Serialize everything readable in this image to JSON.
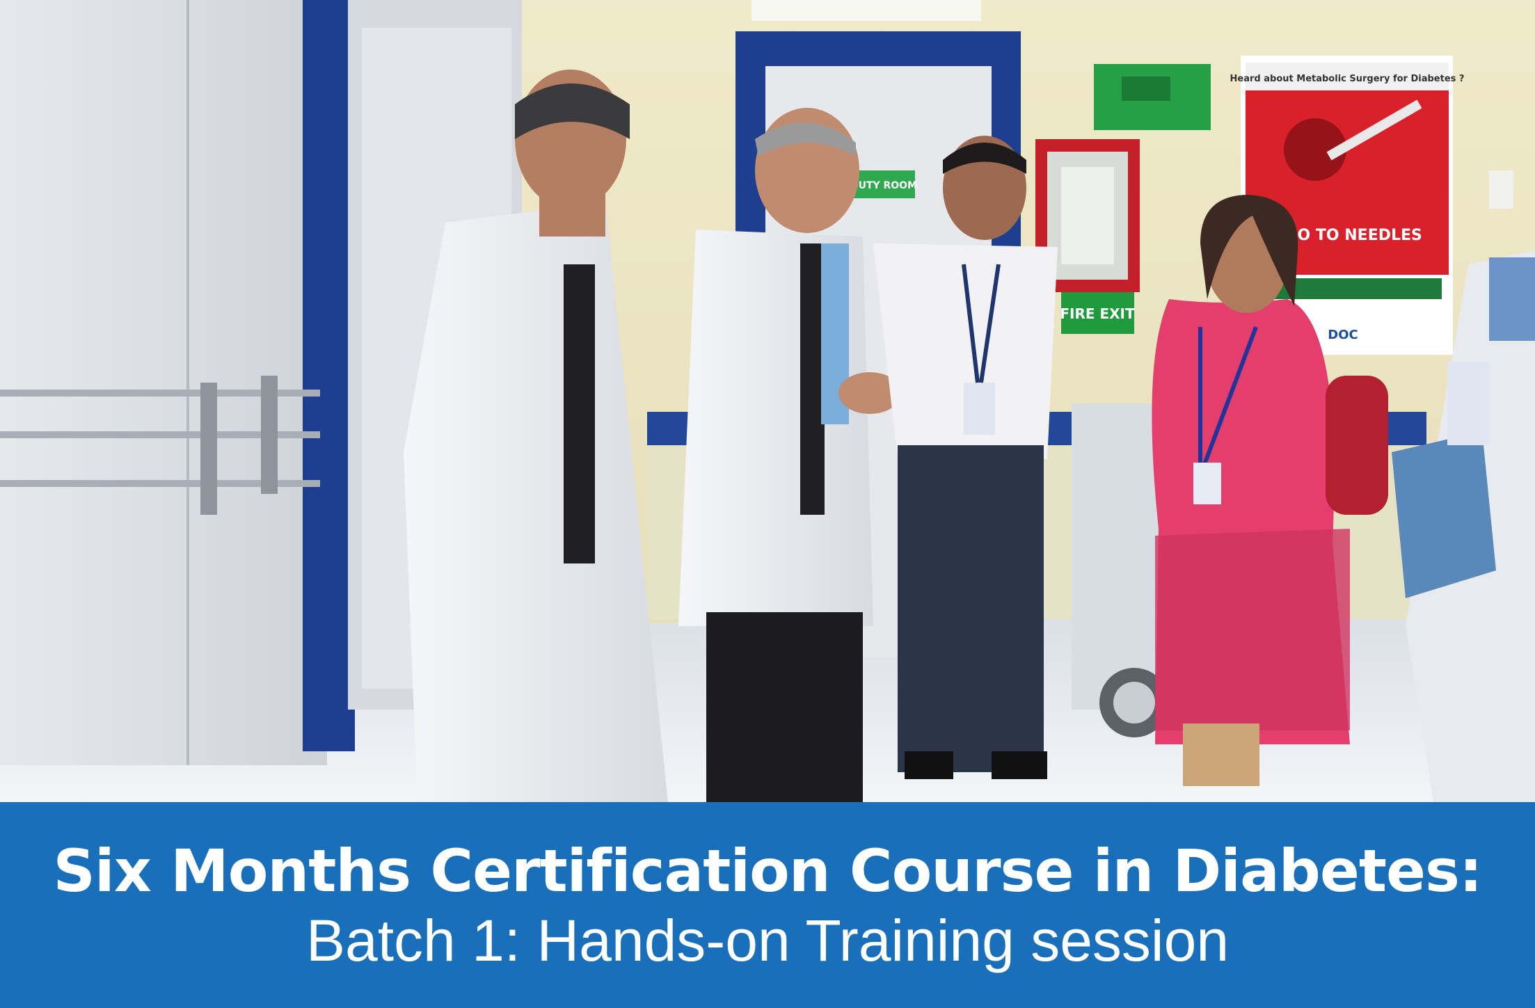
{
  "photo": {
    "signs": {
      "poster_heading": "Heard about Metabolic Surgery for Diabetes ?",
      "poster_slogan": "NO TO NEEDLES",
      "poster_footer": "DOC",
      "exit_sign": "FIRE EXIT",
      "room_sign": "DUTY ROOM"
    }
  },
  "caption": {
    "title": "Six Months Certification Course in Diabetes:",
    "subtitle": "Batch 1: Hands-on Training session"
  },
  "colors": {
    "band": "#1a6fba",
    "caption_text": "#ffffff",
    "wall": "#ebe6c3",
    "door_frame": "#1e3f8f",
    "poster_red": "#d9212b",
    "exit_green": "#1f9a3c"
  }
}
